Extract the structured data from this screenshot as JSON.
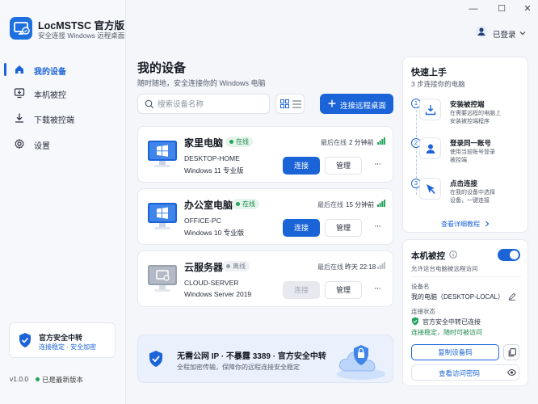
{
  "app": {
    "title": "LocMSTSC 官方版",
    "subtitle": "安全连接 Windows 远程桌面"
  },
  "window_controls": {
    "minimize": "—",
    "maximize": "☐",
    "close": "✕"
  },
  "header": {
    "user_label": "已登录"
  },
  "sidebar": {
    "items": [
      {
        "label": "我的设备",
        "icon": "home-icon",
        "active": true
      },
      {
        "label": "本机被控",
        "icon": "monitor-download-icon",
        "active": false
      },
      {
        "label": "下载被控端",
        "icon": "download-icon",
        "active": false
      },
      {
        "label": "设置",
        "icon": "gear-icon",
        "active": false
      }
    ],
    "security_card": {
      "title": "官方安全中转",
      "subtitle": "连接稳定 · 安全加密"
    },
    "version": "v1.0.0",
    "version_status": "已是最新版本"
  },
  "main": {
    "title": "我的设备",
    "subtitle": "随时随地，安全连接你的 Windows 电脑",
    "search_placeholder": "搜索设备名称",
    "connect_remote_label": "连接远程桌面",
    "devices": [
      {
        "name": "家里电脑",
        "status": "在线",
        "online": true,
        "host": "DESKTOP-HOME",
        "os": "Windows 11 专业版",
        "last_label": "最后在线",
        "last_value": "2 分钟前",
        "connect": "连接",
        "manage": "管理",
        "more": "···"
      },
      {
        "name": "办公室电脑",
        "status": "在线",
        "online": true,
        "host": "OFFICE-PC",
        "os": "Windows 10 专业版",
        "last_label": "最后在线",
        "last_value": "15 分钟前",
        "connect": "连接",
        "manage": "管理",
        "more": "···"
      },
      {
        "name": "云服务器",
        "status": "离线",
        "online": false,
        "host": "CLOUD-SERVER",
        "os": "Windows Server 2019",
        "last_label": "最后在线",
        "last_value": "昨天 22:18",
        "connect": "连接",
        "manage": "管理",
        "more": "···"
      }
    ],
    "banner": {
      "title": "无需公网 IP · 不暴露 3389 · 官方安全中转",
      "subtitle": "全程加密传输，保障你的远程连接安全稳定"
    }
  },
  "quick_start": {
    "title": "快速上手",
    "subtitle": "3 步连接你的电脑",
    "steps": [
      {
        "num": "1",
        "title": "安装被控端",
        "desc1": "在需要远程的电脑上",
        "desc2": "安装被控端程序",
        "icon": "download-tray-icon"
      },
      {
        "num": "2",
        "title": "登录同一账号",
        "desc1": "使用当前账号登录",
        "desc2": "被控端",
        "icon": "user-icon"
      },
      {
        "num": "3",
        "title": "点击连接",
        "desc1": "在我的设备中选择",
        "desc2": "设备，一键连接",
        "icon": "cursor-icon"
      }
    ],
    "more_link": "查看详细教程"
  },
  "local_control": {
    "title": "本机被控",
    "subtitle": "允许这台电脑被远程访问",
    "enabled": true,
    "device_name_label": "设备名",
    "device_name_value": "我的电脑（DESKTOP-LOCAL）",
    "conn_status_label": "连接状态",
    "conn_status_value": "官方安全中转已连接",
    "conn_status_note": "连接稳定，随时可被访问",
    "copy_code_label": "复制设备码",
    "view_password_label": "查看访问密码"
  },
  "colors": {
    "accent": "#1b64d8",
    "online": "#22a35a",
    "offline": "#9aa0ab"
  }
}
